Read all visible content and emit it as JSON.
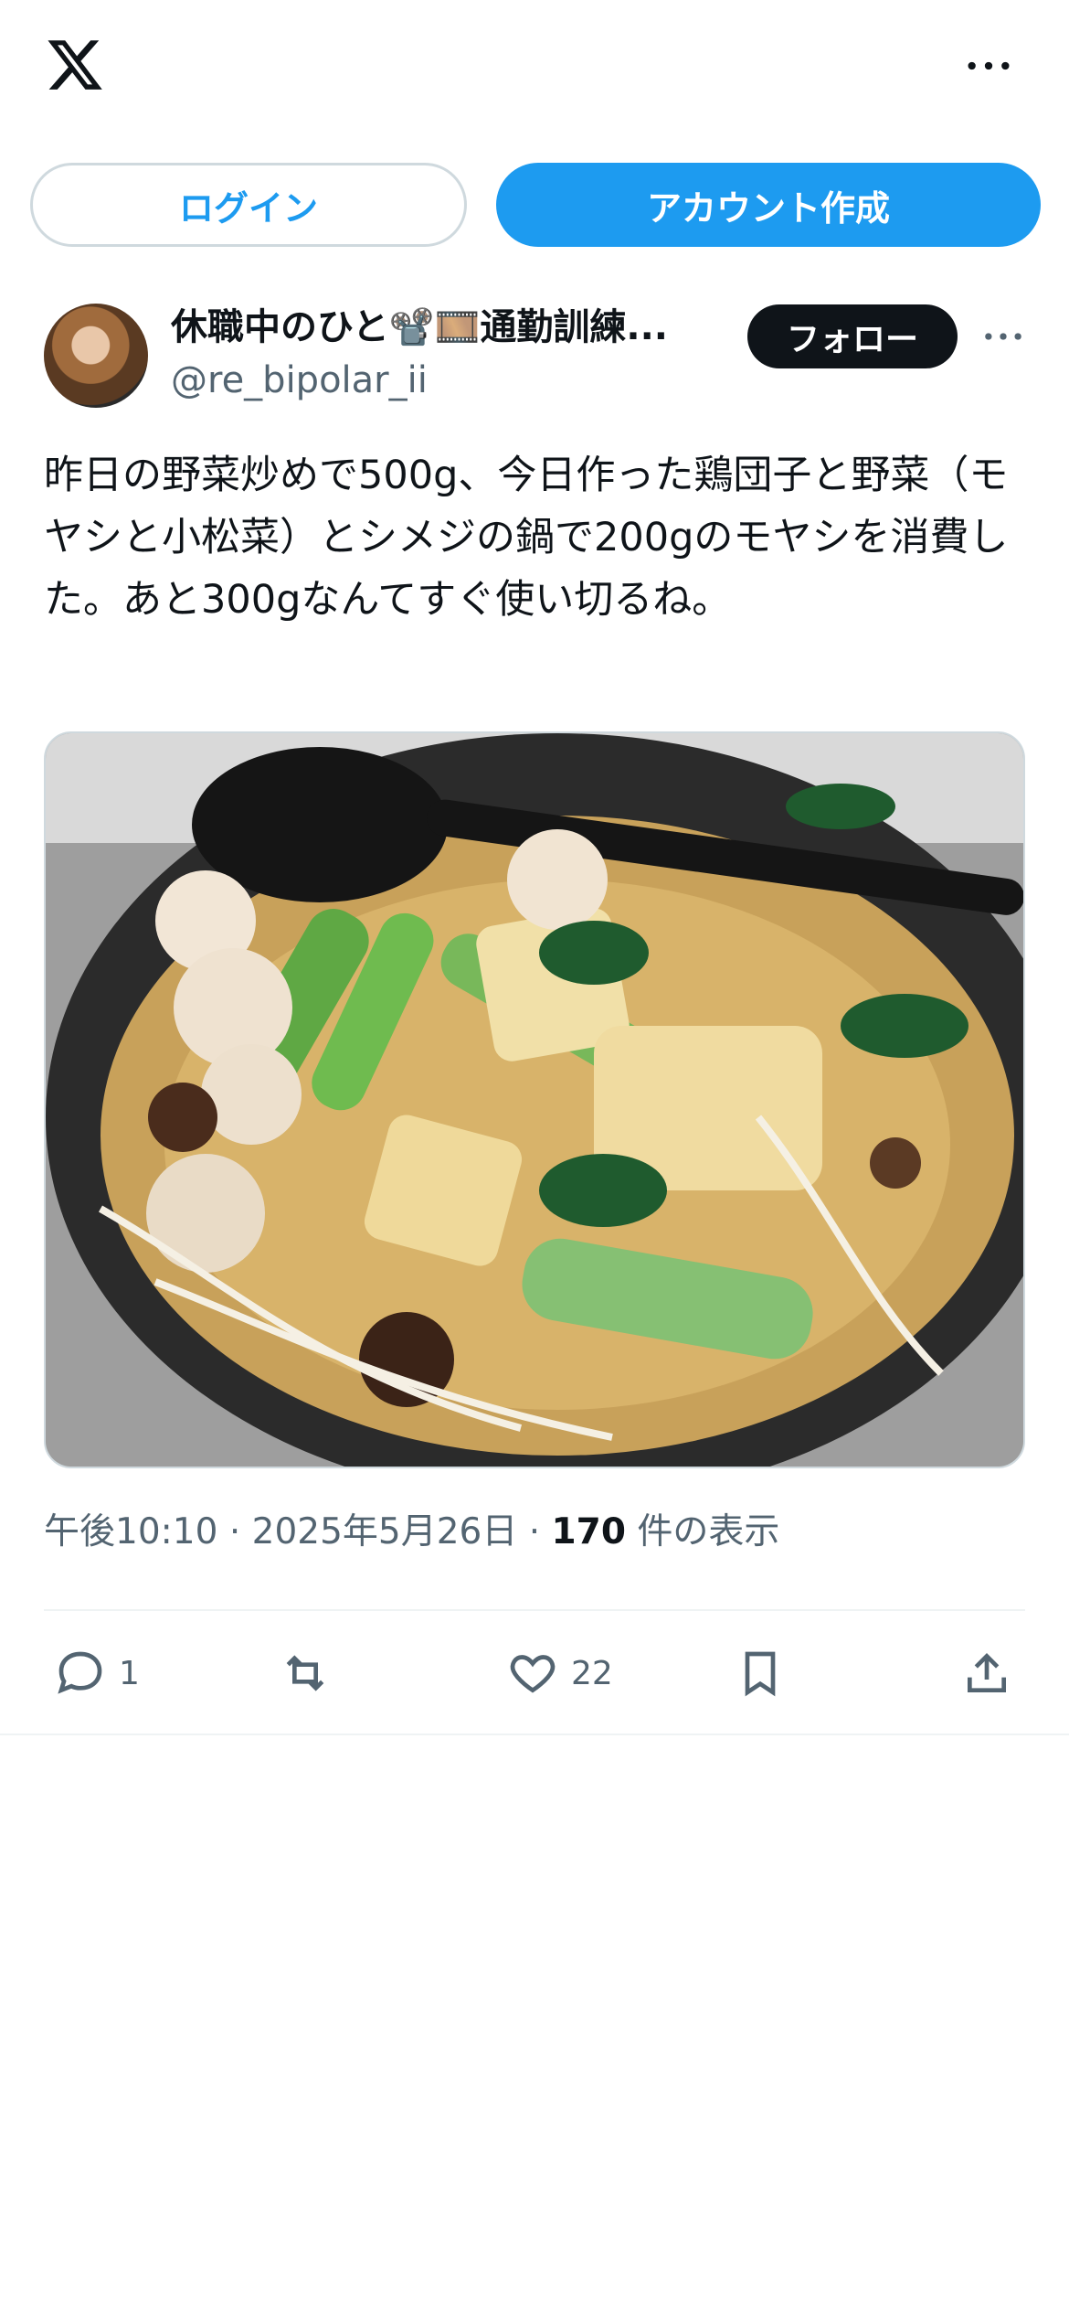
{
  "header": {
    "logo_icon": "x-logo-icon",
    "more_icon": "more-horizontal-icon"
  },
  "auth": {
    "login_label": "ログイン",
    "signup_label": "アカウント作成"
  },
  "post": {
    "author_name": "休職中のひと📽️🎞️通勤訓練...",
    "handle": "@re_bipolar_ii",
    "follow_label": "フォロー",
    "text": "昨日の野菜炒めで500g、今日作った鶏団子と野菜（モヤシと小松菜）とシメジの鍋で200gのモヤシを消費した。あと300gなんてすぐ使い切るね。",
    "time": "午後10:10",
    "date": "2025年5月26日",
    "separator": "·",
    "views_count": "170",
    "views_label": "件の表示"
  },
  "actions": {
    "reply_count": "1",
    "repost_count": "",
    "like_count": "22"
  },
  "colors": {
    "accent": "#1d9bf0",
    "text": "#0f1419",
    "muted": "#536471",
    "border": "#cfd9de"
  }
}
